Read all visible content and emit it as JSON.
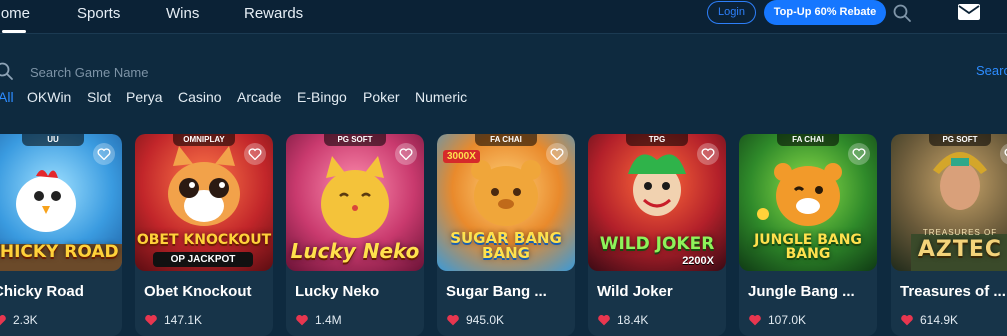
{
  "nav": {
    "items": [
      {
        "label": "Home"
      },
      {
        "label": "Sports"
      },
      {
        "label": "Wins"
      },
      {
        "label": "Rewards"
      }
    ],
    "login_label": "Login",
    "topup_label": "Top-Up 60% Rebate"
  },
  "search": {
    "placeholder": "Search Game Name",
    "button_label": "Search"
  },
  "categories": [
    {
      "label": "All",
      "active": true
    },
    {
      "label": "OKWin"
    },
    {
      "label": "Slot"
    },
    {
      "label": "Perya"
    },
    {
      "label": "Casino"
    },
    {
      "label": "Arcade"
    },
    {
      "label": "E-Bingo"
    },
    {
      "label": "Poker"
    },
    {
      "label": "Numeric"
    }
  ],
  "games": [
    {
      "name": "Chicky Road",
      "likes": "2.3K",
      "provider": "UU",
      "art_text": "CHICKY ROAD"
    },
    {
      "name": "Obet Knockout",
      "likes": "147.1K",
      "provider": "OMNIPLAY",
      "art_text": "OBET KNOCKOUT",
      "art_sub": "OP JACKPOT"
    },
    {
      "name": "Lucky Neko",
      "likes": "1.4M",
      "provider": "PG SOFT",
      "art_text": "Lucky Neko"
    },
    {
      "name": "Sugar Bang ...",
      "likes": "945.0K",
      "provider": "FA CHAI",
      "art_text": "SUGAR BANG BANG",
      "art_badge": "3000X"
    },
    {
      "name": "Wild Joker",
      "likes": "18.4K",
      "provider": "TPG",
      "art_text": "WILD JOKER",
      "art_sub": "2200X"
    },
    {
      "name": "Jungle Bang ...",
      "likes": "107.0K",
      "provider": "FA CHAI",
      "art_text": "JUNGLE BANG BANG"
    },
    {
      "name": "Treasures of ...",
      "likes": "614.9K",
      "provider": "PG SOFT",
      "art_text": "AZTEC",
      "art_sub": "TREASURES OF"
    }
  ],
  "colors": {
    "background": "#0e2a3f",
    "accent": "#1677ff",
    "heart": "#e8364f"
  }
}
